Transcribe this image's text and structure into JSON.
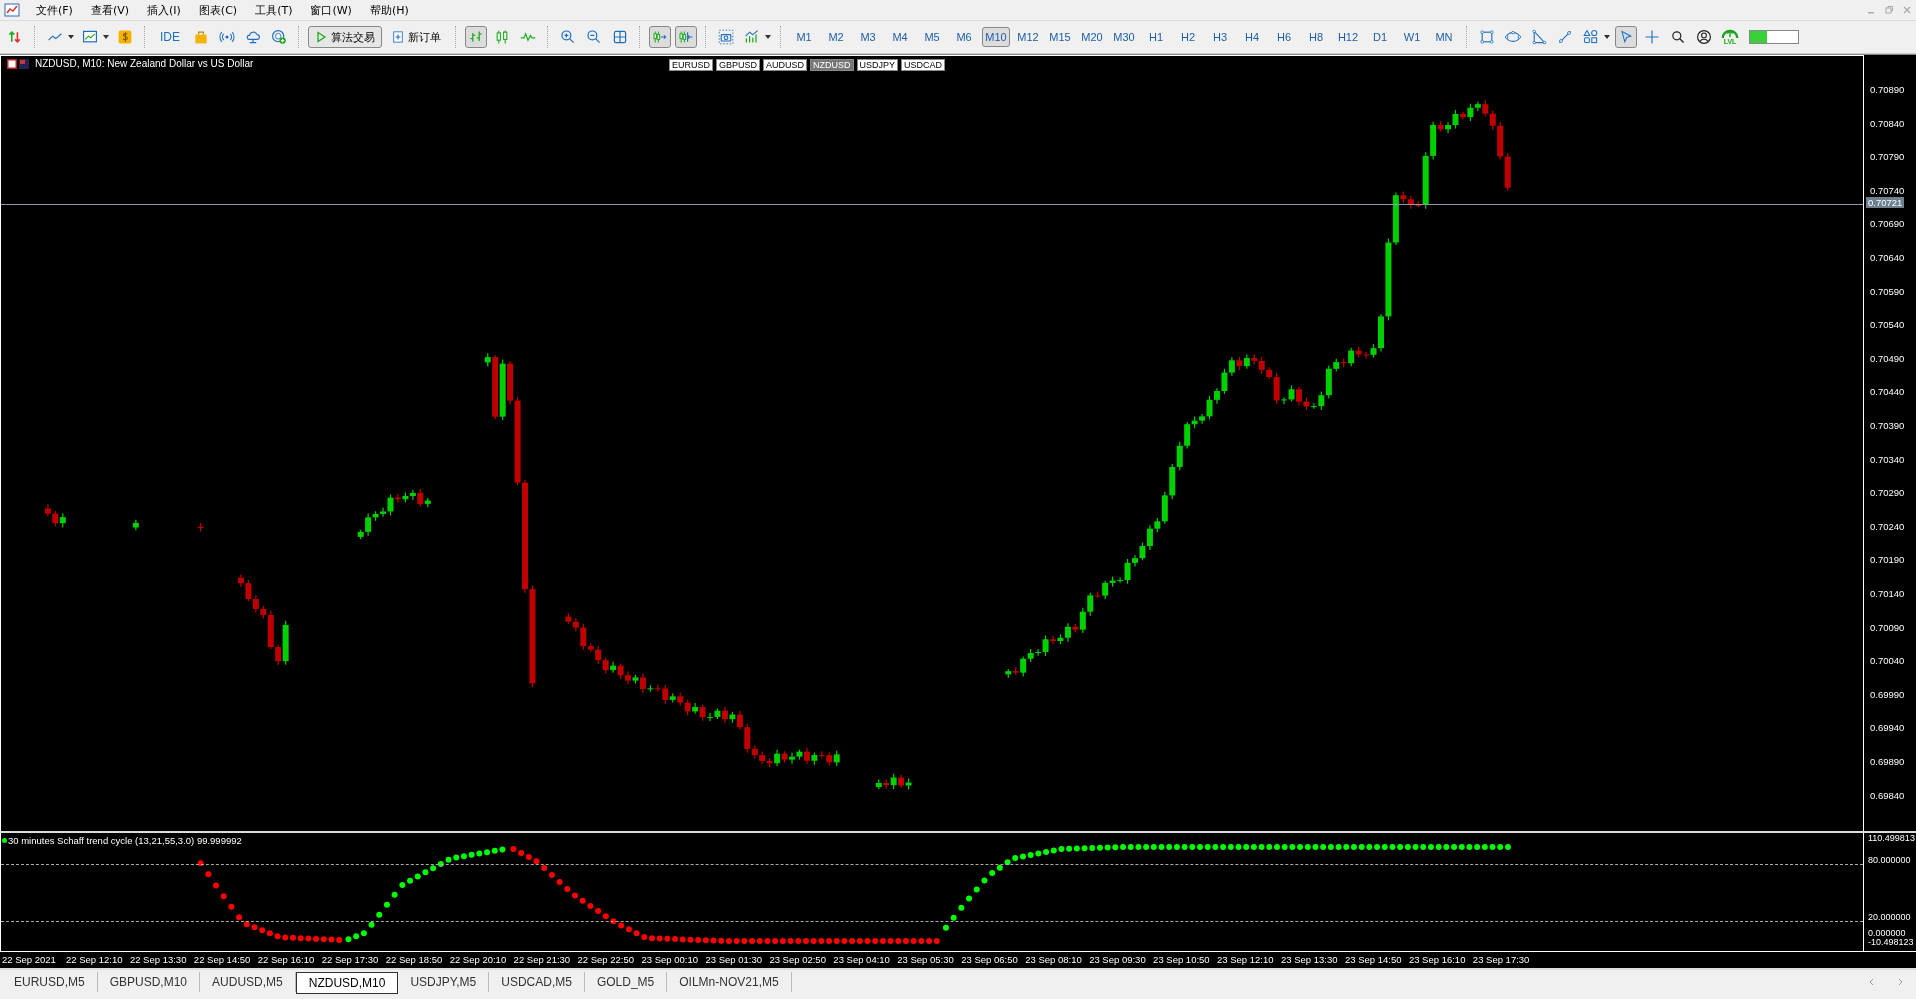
{
  "menu": [
    "文件(F)",
    "查看(V)",
    "插入(I)",
    "图表(C)",
    "工具(T)",
    "窗口(W)",
    "帮助(H)"
  ],
  "toolbar": {
    "ide": "IDE",
    "algo_trading": "算法交易",
    "new_order": "新订单",
    "chart_types": [
      {
        "selected": true
      },
      {
        "selected": false
      },
      {
        "selected": false
      }
    ],
    "scroll_toggles": [
      {
        "on": true
      },
      {
        "on": true
      }
    ],
    "timeframes": [
      {
        "label": "M1",
        "selected": false
      },
      {
        "label": "M2",
        "selected": false
      },
      {
        "label": "M3",
        "selected": false
      },
      {
        "label": "M4",
        "selected": false
      },
      {
        "label": "M5",
        "selected": false
      },
      {
        "label": "M6",
        "selected": false
      },
      {
        "label": "M10",
        "selected": true
      },
      {
        "label": "M12",
        "selected": false
      },
      {
        "label": "M15",
        "selected": false
      },
      {
        "label": "M20",
        "selected": false
      },
      {
        "label": "M30",
        "selected": false
      },
      {
        "label": "H1",
        "selected": false
      },
      {
        "label": "H2",
        "selected": false
      },
      {
        "label": "H3",
        "selected": false
      },
      {
        "label": "H4",
        "selected": false
      },
      {
        "label": "H6",
        "selected": false
      },
      {
        "label": "H8",
        "selected": false
      },
      {
        "label": "H12",
        "selected": false
      },
      {
        "label": "D1",
        "selected": false
      },
      {
        "label": "W1",
        "selected": false
      },
      {
        "label": "MN",
        "selected": false
      }
    ],
    "pointer_tools": [
      {
        "selected": true
      },
      {
        "selected": false
      }
    ],
    "level_badge": "LVL",
    "connection": {
      "level": 0.35
    }
  },
  "chart": {
    "title": "NZDUSD, M10:  New Zealand Dollar vs US Dollar",
    "symbols": [
      {
        "label": "EURUSD",
        "selected": false
      },
      {
        "label": "GBPUSD",
        "selected": false
      },
      {
        "label": "AUDUSD",
        "selected": false
      },
      {
        "label": "NZDUSD",
        "selected": true
      },
      {
        "label": "USDJPY",
        "selected": false
      },
      {
        "label": "USDCAD",
        "selected": false
      }
    ],
    "price_ticks": [
      "0.70890",
      "0.70840",
      "0.70790",
      "0.70740",
      "0.70690",
      "0.70640",
      "0.70590",
      "0.70540",
      "0.70490",
      "0.70440",
      "0.70390",
      "0.70340",
      "0.70290",
      "0.70240",
      "0.70190",
      "0.70140",
      "0.70090",
      "0.70040",
      "0.69990",
      "0.69940",
      "0.69890",
      "0.69840"
    ],
    "current_price": "0.70721"
  },
  "indicator": {
    "label": "30 minutes Schaff trend cycle (13,21,55,3.0) 99.999992",
    "levels": [
      "110.499813",
      "80.000000",
      "20.000000",
      "0.000000",
      "-10.498123"
    ]
  },
  "time_axis": [
    "22 Sep 2021",
    "22 Sep 12:10",
    "22 Sep 13:30",
    "22 Sep 14:50",
    "22 Sep 16:10",
    "22 Sep 17:30",
    "22 Sep 18:50",
    "22 Sep 20:10",
    "22 Sep 21:30",
    "22 Sep 22:50",
    "23 Sep 00:10",
    "23 Sep 01:30",
    "23 Sep 02:50",
    "23 Sep 04:10",
    "23 Sep 05:30",
    "23 Sep 06:50",
    "23 Sep 08:10",
    "23 Sep 09:30",
    "23 Sep 10:50",
    "23 Sep 12:10",
    "23 Sep 13:30",
    "23 Sep 14:50",
    "23 Sep 16:10",
    "23 Sep 17:30"
  ],
  "chart_tabs": [
    {
      "label": "EURUSD,M5",
      "selected": false
    },
    {
      "label": "GBPUSD,M10",
      "selected": false
    },
    {
      "label": "AUDUSD,M5",
      "selected": false
    },
    {
      "label": "NZDUSD,M10",
      "selected": true
    },
    {
      "label": "USDJPY,M5",
      "selected": false
    },
    {
      "label": "USDCAD,M5",
      "selected": false
    },
    {
      "label": "GOLD_M5",
      "selected": false
    },
    {
      "label": "OILMn-NOV21,M5",
      "selected": false
    }
  ]
}
